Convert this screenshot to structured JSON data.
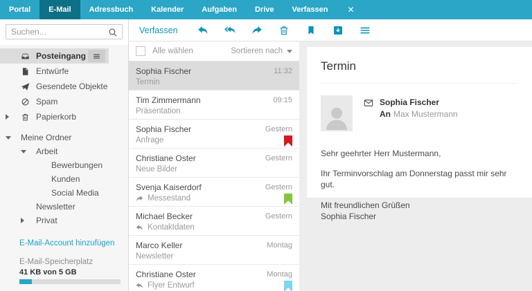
{
  "colors": {
    "topbar": "#2ba6c6",
    "topbar_active": "#0e7086",
    "accent": "#0d93b5",
    "link": "#1da5c7",
    "selection": "#dcdcdc",
    "flag_red": "#d51920",
    "flag_green": "#85c441",
    "flag_blue": "#7fd6f0"
  },
  "topbar": {
    "tabs": [
      {
        "label": "Portal",
        "active": false
      },
      {
        "label": "E-Mail",
        "active": true
      },
      {
        "label": "Adressbuch",
        "active": false
      },
      {
        "label": "Kalender",
        "active": false
      },
      {
        "label": "Aufgaben",
        "active": false
      },
      {
        "label": "Drive",
        "active": false
      },
      {
        "label": "Verfassen",
        "active": false
      }
    ],
    "close_label": "✕"
  },
  "sidebar": {
    "search_placeholder": "Suchen...",
    "folders": [
      {
        "icon": "inbox-icon",
        "label": "Posteingang",
        "selected": true,
        "menu": true
      },
      {
        "icon": "draft-icon",
        "label": "Entwürfe"
      },
      {
        "icon": "sent-icon",
        "label": "Gesendete Objekte"
      },
      {
        "icon": "spam-icon",
        "label": "Spam"
      },
      {
        "icon": "trash-icon",
        "label": "Papierkorb",
        "caret": "right"
      }
    ],
    "tree": [
      {
        "label": "Meine Ordner",
        "caret": "down",
        "indent": 0
      },
      {
        "label": "Arbeit",
        "caret": "down",
        "indent": 1
      },
      {
        "label": "Bewerbungen",
        "indent": 2
      },
      {
        "label": "Kunden",
        "indent": 2
      },
      {
        "label": "Social Media",
        "indent": 2
      },
      {
        "label": "Newsletter",
        "indent": 1
      },
      {
        "label": "Privat",
        "caret": "right",
        "indent": 1
      }
    ],
    "add_account_label": "E-Mail-Account hinzufügen",
    "quota": {
      "label": "E-Mail-Speicherplatz",
      "value": "41 KB von 5 GB",
      "percent": 12
    }
  },
  "toolbar": {
    "compose_label": "Verfassen",
    "icons": [
      "reply-icon",
      "reply-all-icon",
      "forward-icon",
      "delete-icon",
      "flag-icon",
      "archive-icon",
      "menu-icon"
    ]
  },
  "list": {
    "select_all_label": "Alle wählen",
    "sort_label": "Sortieren nach",
    "items": [
      {
        "sender": "Sophia Fischer",
        "subject": "Termin",
        "date": "11:32",
        "selected": true
      },
      {
        "sender": "Tim Zimmermann",
        "subject": "Präsentation",
        "date": "09:15"
      },
      {
        "sender": "Sophia Fischer",
        "subject": "Anfrage",
        "date": "Gestern",
        "flag_color": "#d51920"
      },
      {
        "sender": "Christiane Oster",
        "subject": "Neue Bilder",
        "date": "Gestern"
      },
      {
        "sender": "Svenja Kaiserdorf",
        "subject": "Messestand",
        "date": "Gestern",
        "flag_color": "#85c441",
        "subject_icon": "forward-icon"
      },
      {
        "sender": "Michael Becker",
        "subject": "Kontaktdaten",
        "date": "Gestern",
        "subject_icon": "reply-icon"
      },
      {
        "sender": "Marco Keller",
        "subject": "Newsletter",
        "date": "Montag"
      },
      {
        "sender": "Christiane Oster",
        "subject": "Flyer Entwurf",
        "date": "Montag",
        "flag_color": "#7fd6f0",
        "subject_icon": "reply-icon"
      }
    ]
  },
  "detail": {
    "subject": "Termin",
    "sender": "Sophia Fischer",
    "to_label": "An",
    "recipient": "Max Mustermann",
    "body": [
      "Sehr geehrter Herr Mustermann,",
      "Ihr Terminvorschlag am Donnerstag passt mir sehr gut.",
      "Mit freundlichen Grüßen\nSophia Fischer"
    ]
  }
}
